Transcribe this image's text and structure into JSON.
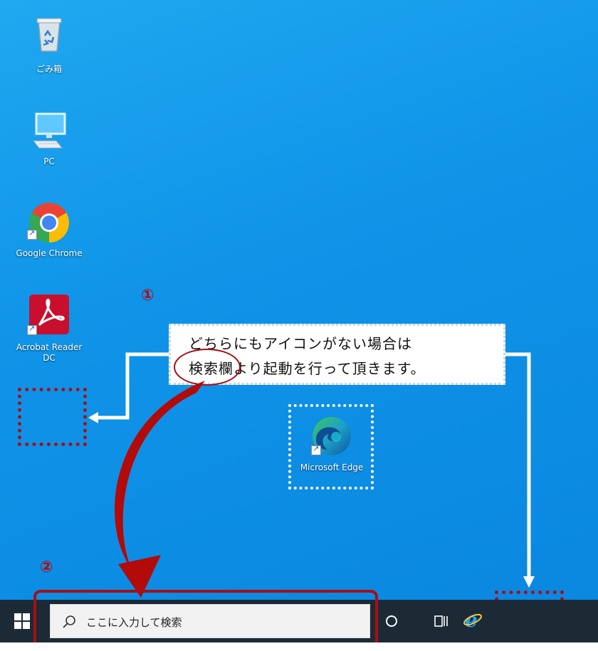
{
  "desktop": {
    "icons": [
      {
        "label": "ごみ箱"
      },
      {
        "label": "PC"
      },
      {
        "label": "Google Chrome"
      },
      {
        "label_line1": "Acrobat Reader",
        "label_line2": "DC"
      },
      {
        "label": "Microsoft Edge"
      }
    ]
  },
  "annotations": {
    "step1": "①",
    "step2": "②",
    "callout_line1": "どちらにもアイコンがない場合は",
    "callout_line2": "検索欄より起動を行って頂きます。"
  },
  "taskbar": {
    "search_placeholder": "ここに入力して検索"
  },
  "colors": {
    "desktop": "#0f94e8",
    "taskbar": "#1c2a36",
    "highlight_red": "#a80e14",
    "arrow_red": "#b30a0a"
  }
}
